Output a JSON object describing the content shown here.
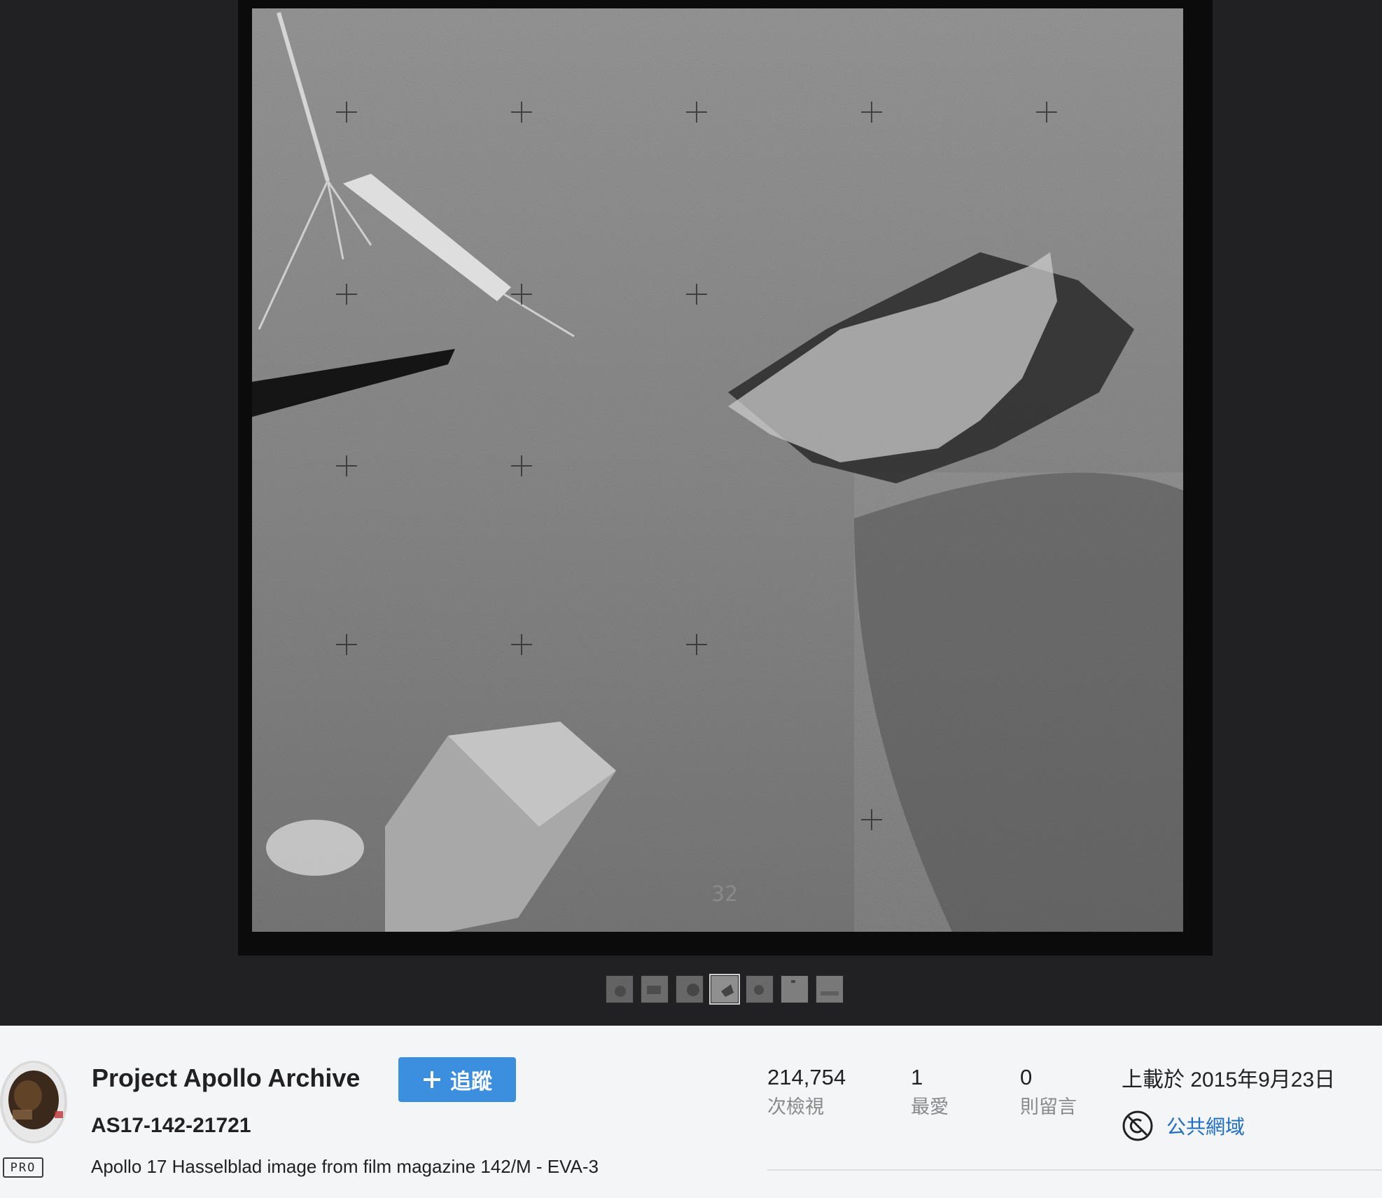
{
  "viewer": {
    "photo_alt": "Apollo 17 lunar surface with excavated trench",
    "filmstrip": {
      "thumbnails": [
        "thumb-1",
        "thumb-2",
        "thumb-3",
        "thumb-4",
        "thumb-5",
        "thumb-6",
        "thumb-7"
      ],
      "active_index": 3
    },
    "frame_number": "32"
  },
  "owner": {
    "name": "Project Apollo Archive",
    "badge": "PRO",
    "avatar_icon": "astronaut-avatar"
  },
  "follow": {
    "icon": "plus-icon",
    "label": "追蹤"
  },
  "photo": {
    "title": "AS17-142-21721",
    "description": "Apollo 17 Hasselblad image from film magazine 142/M - EVA-3"
  },
  "stats": {
    "views": {
      "value": "214,754",
      "label": "次檢視"
    },
    "faves": {
      "value": "1",
      "label": "最愛"
    },
    "comments": {
      "value": "0",
      "label": "則留言"
    }
  },
  "upload": {
    "text": "上載於 2015年9月23日"
  },
  "license": {
    "icon": "public-domain-icon",
    "label": "公共網域"
  },
  "colors": {
    "viewer_bg": "#212124",
    "info_bg": "#f3f5f6",
    "accent": "#3c8fdf",
    "link": "#1f6ec2"
  }
}
